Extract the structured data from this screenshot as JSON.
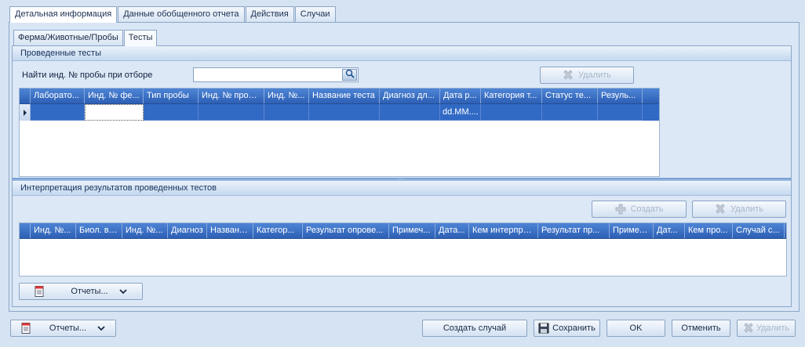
{
  "main_tabs": [
    {
      "label": "Детальная информация",
      "active": true
    },
    {
      "label": "Данные обобщенного отчета",
      "active": false
    },
    {
      "label": "Действия",
      "active": false
    },
    {
      "label": "Случаи",
      "active": false
    }
  ],
  "sub_tabs": [
    {
      "label": "Ферма/Животные/Пробы",
      "active": false
    },
    {
      "label": "Тесты",
      "active": true
    }
  ],
  "tests_section": {
    "title": "Проведенные тесты",
    "search_label": "Найти инд. № пробы при отборе",
    "search_value": "",
    "delete_label": "Удалить",
    "grid": {
      "columns": [
        "Лаборато...",
        "Инд. № фе...",
        "Тип пробы",
        "Инд. № проб...",
        "Инд. №...",
        "Название теста",
        "Диагноз дл...",
        "Дата р...",
        "Категория т...",
        "Статус те...",
        "Резуль..."
      ],
      "rows": [
        [
          "",
          "",
          "",
          "",
          "",
          "",
          "",
          "dd.MM....",
          "",
          "",
          ""
        ]
      ]
    }
  },
  "interpretation_section": {
    "title": "Интерпретация результатов проведенных тестов",
    "create_label": "Создать",
    "delete_label": "Удалить",
    "grid": {
      "columns": [
        "Инд. №...",
        "Биол. вид",
        "Инд. №...",
        "Диагноз",
        "Названи...",
        "Категор...",
        "Результат опрове...",
        "Примеч...",
        "Дата...",
        "Кем интерпре...",
        "Результат пр...",
        "Примеч...",
        "Дат...",
        "Кем про...",
        "Случай с..."
      ]
    },
    "reports_label": "Отчеты..."
  },
  "footer": {
    "reports_label": "Отчеты...",
    "create_case_label": "Создать случай",
    "save_label": "Сохранить",
    "ok_label": "OK",
    "cancel_label": "Отменить",
    "delete_label": "Удалить"
  },
  "icons": {
    "search": "magnifier-icon",
    "delete": "x-icon",
    "create": "plus-icon",
    "reports": "report-icon",
    "save": "floppy-icon",
    "dropdown": "chevron-down-icon"
  }
}
